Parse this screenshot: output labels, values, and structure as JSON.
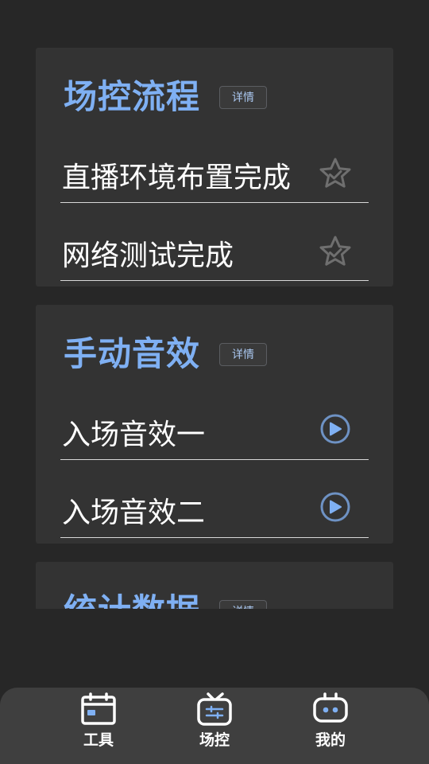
{
  "cards": [
    {
      "title": "场控流程",
      "detail_label": "详情",
      "items": [
        {
          "label": "直播环境布置完成",
          "icon": "star-check-icon"
        },
        {
          "label": "网络测试完成",
          "icon": "star-check-icon"
        }
      ]
    },
    {
      "title": "手动音效",
      "detail_label": "详情",
      "items": [
        {
          "label": "入场音效一",
          "icon": "play-icon"
        },
        {
          "label": "入场音效二",
          "icon": "play-icon"
        }
      ]
    },
    {
      "title": "统计数据",
      "detail_label": "详情"
    }
  ],
  "tabbar": {
    "items": [
      {
        "label": "工具",
        "icon": "calendar-icon"
      },
      {
        "label": "场控",
        "icon": "tv-settings-icon"
      },
      {
        "label": "我的",
        "icon": "robot-face-icon"
      }
    ]
  },
  "colors": {
    "background": "#272727",
    "card": "#333333",
    "accent": "#7fb0f3",
    "icon_gray": "#6f6f6f",
    "play_blue": "#6e92c4"
  }
}
